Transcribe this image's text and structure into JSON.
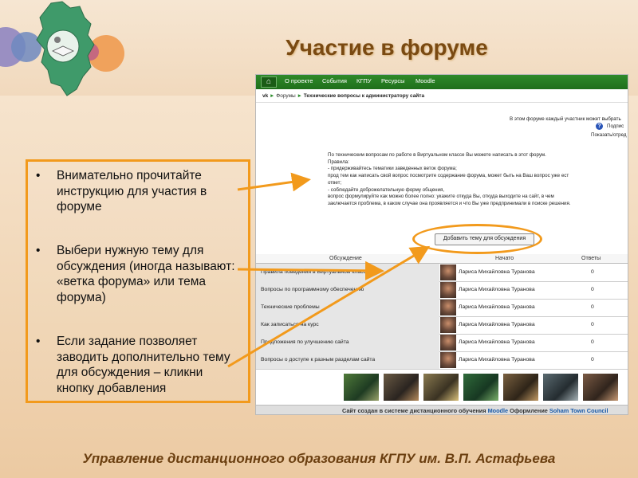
{
  "slide": {
    "title": "Участие в форуме",
    "footer": "Управление дистанционного образования КГПУ им. В.П. Астафьева"
  },
  "bullets": [
    "Внимательно прочитайте инструкцию для участия в форуме",
    "Выбери нужную тему для обсуждения (иногда называют: «ветка форума» или тема форума)",
    "Если задание позволяет заводить дополнительно тему для обсуждения – кликни кнопку добавления"
  ],
  "site": {
    "nav": [
      "О проекте",
      "События",
      "КГПУ",
      "Ресурсы",
      "Moodle"
    ],
    "breadcrumb": {
      "root": "vk",
      "sep": "►",
      "forums": "Форумы",
      "current": "Технические вопросы к администратору сайта"
    },
    "side_note": "В этом форуме каждый участник может выбрать",
    "subscribe": "Подпис",
    "show": "Показать/отред",
    "intro_lines": [
      "По техническим вопросам по работе в Виртуальном классе Вы можете написать в этот форум.",
      "Правила:",
      "- придерживайтесь тематики заведенных веток форума;",
      "  прод тем как написать свой вопрос посмотрите содержание форума, может быть на Ваш вопрос уже ест",
      "ответ;",
      "- соблюдайте доброжелательную форму общения,",
      "  вопрос формулируйте как можно более полно: укажите откуда Вы, откуда выходите на сайт, в чем",
      "заключается проблема, в каком случае она проявляется и что Вы уже предпринимали в поиске решения."
    ],
    "add_button": "Добавить тему для обсуждения",
    "table_headers": {
      "topic": "Обсуждение",
      "started": "Начато",
      "replies": "Ответы"
    },
    "rows": [
      {
        "topic": "Правила поведения в Виртуальном классе",
        "author": "Лариса Михайловна Туранова",
        "replies": "0"
      },
      {
        "topic": "Вопросы по программному обеспечению",
        "author": "Лариса Михайловна Туранова",
        "replies": "0"
      },
      {
        "topic": "Технические проблемы",
        "author": "Лариса Михайловна Туранова",
        "replies": "0"
      },
      {
        "topic": "Как записаться на курс",
        "author": "Лариса Михайловна Туранова",
        "replies": "0"
      },
      {
        "topic": "Предложения по улучшению сайта",
        "author": "Лариса Михайловна Туранова",
        "replies": "0"
      },
      {
        "topic": "Вопросы о доступе к разным разделам сайта",
        "author": "Лариса Михайловна Туранова",
        "replies": "0"
      }
    ],
    "footer": {
      "prefix": "Сайт создан в системе дистанционного обучения",
      "moodle": "Moodle",
      "design": "Оформление",
      "council": "Soham Town Council"
    }
  },
  "colors": {
    "accent_orange": "#f29a1c",
    "nav_green": "#2f8a2a",
    "title_brown": "#7a4a12"
  }
}
